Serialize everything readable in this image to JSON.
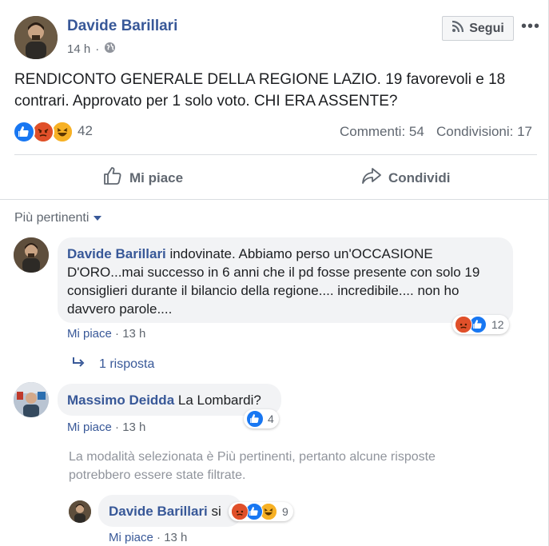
{
  "post": {
    "author": "Davide Barillari",
    "time": "14 h",
    "privacy_icon": "globe-icon",
    "follow_label": "Segui",
    "more_label": "•••",
    "text": "RENDICONTO GENERALE DELLA REGIONE LAZIO. 19 favorevoli e 18 contrari. Approvato per 1 solo voto. CHI ERA ASSENTE?",
    "reactions": [
      "like",
      "angry",
      "haha"
    ],
    "reaction_count": "42",
    "comments_label": "Commenti: 54",
    "shares_label": "Condivisioni: 17",
    "like_label": "Mi piace",
    "share_label": "Condividi"
  },
  "filter": {
    "label": "Più pertinenti"
  },
  "comments": [
    {
      "author": "Davide Barillari",
      "text": " indovinate. Abbiamo perso un'OCCASIONE D'ORO...mai successo in 6 anni che il pd fosse presente con solo 19 consiglieri durante il bilancio della regione.... incredibile.... non ho davvero parole....",
      "like": "Mi piace",
      "sep": " · ",
      "time": "13 h",
      "reaction_count": "12",
      "reply_label": "1 risposta"
    },
    {
      "author": "Massimo Deidda",
      "text": " La Lombardi?",
      "like": "Mi piace",
      "sep": " · ",
      "time": "13 h",
      "reaction_count": "4"
    }
  ],
  "filter_notice": "La modalità selezionata è Più pertinenti, pertanto alcune risposte potrebbero essere state filtrate.",
  "reply": {
    "author": "Davide Barillari",
    "text": " si",
    "like": "Mi piace",
    "sep": " · ",
    "time": "13 h",
    "reaction_count": "9"
  },
  "colors": {
    "link": "#385898",
    "like_blue": "#1877f2",
    "angry_red": "#e9710f",
    "haha_yellow": "#f7b125",
    "bubble_bg": "#f2f3f5"
  }
}
